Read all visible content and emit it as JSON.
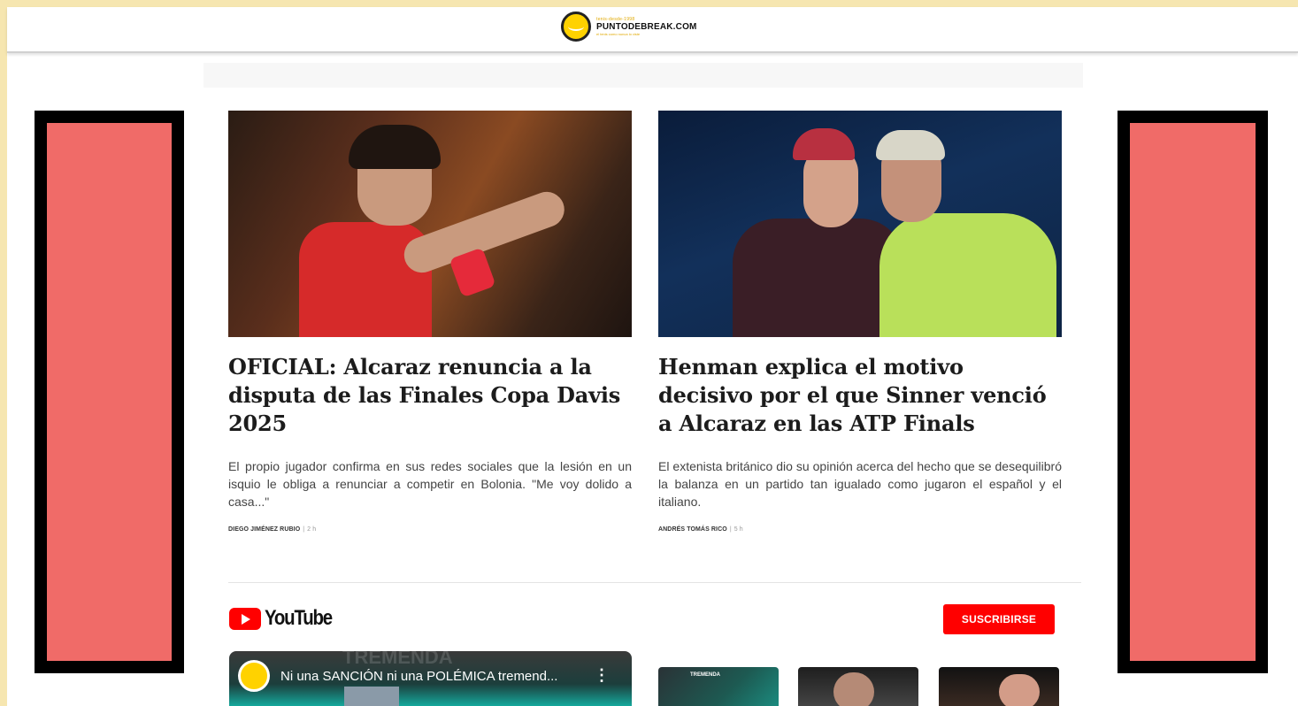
{
  "site": {
    "logo_text": "PUNTODEBREAK.COM",
    "logo_small": "tenis-desde-1998",
    "logo_sub": "el tenis como nunca lo viste"
  },
  "articles": [
    {
      "headline": "OFICIAL: Alcaraz renuncia a la disputa de las Finales Copa Davis 2025",
      "summary": "El propio jugador confirma en sus redes sociales que la lesión en un isquio le obliga a renunciar a competir en Bolonia. \"Me voy dolido a casa...\"",
      "author": "DIEGO JIMÉNEZ RUBIO",
      "time": "2 h"
    },
    {
      "headline": "Henman explica el motivo decisivo por el que Sinner venció a Alcaraz en las ATP Finals",
      "summary": "El extenista británico dio su opinión acerca del hecho que se desequilibró la balanza en un partido tan igualado como jugaron el español y el italiano.",
      "author": "ANDRÉS TOMÁS RICO",
      "time": "5 h"
    }
  ],
  "youtube": {
    "brand": "YouTube",
    "subscribe_label": "SUSCRIBIRSE",
    "featured_video_title": "Ni una SANCIÓN ni una POLÉMICA tremend...",
    "featured_video_watermark": "TREMENDA",
    "thumb1_label": "TREMENDA"
  },
  "colors": {
    "page_border": "#f6e6b0",
    "ad_fill": "#f06b68",
    "youtube_red": "#ff0000"
  }
}
